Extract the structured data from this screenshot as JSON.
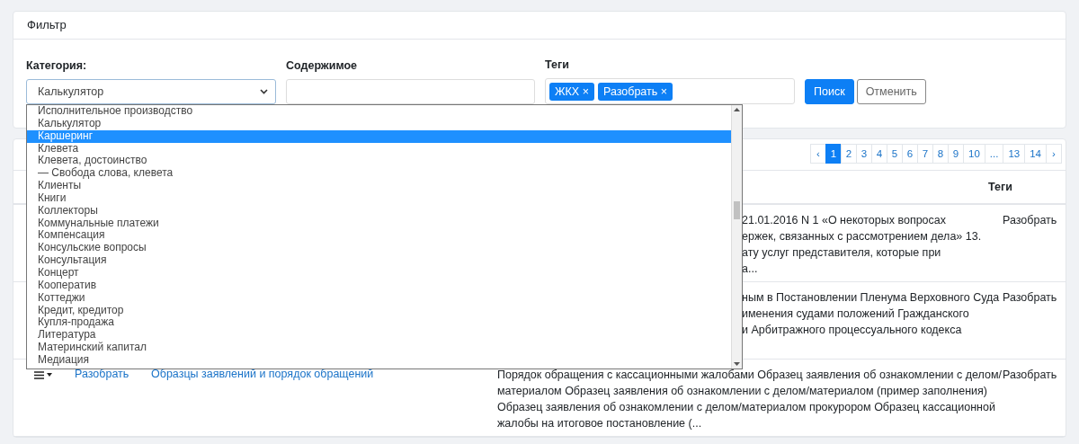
{
  "filter": {
    "title": "Фильтр",
    "category": {
      "label": "Категория:",
      "value": "Калькулятор",
      "expanded": true,
      "options": [
        {
          "label": "Исполнительное производство",
          "highlighted": false
        },
        {
          "label": "Калькулятор",
          "highlighted": false
        },
        {
          "label": "Каршеринг",
          "highlighted": true
        },
        {
          "label": "Клевета",
          "highlighted": false
        },
        {
          "label": "Клевета, достоинство",
          "highlighted": false
        },
        {
          "label": "— Свобода слова, клевета",
          "highlighted": false
        },
        {
          "label": "Клиенты",
          "highlighted": false
        },
        {
          "label": "Книги",
          "highlighted": false
        },
        {
          "label": "Коллекторы",
          "highlighted": false
        },
        {
          "label": "Коммунальные платежи",
          "highlighted": false
        },
        {
          "label": "Компенсация",
          "highlighted": false
        },
        {
          "label": "Консульские вопросы",
          "highlighted": false
        },
        {
          "label": "Консультация",
          "highlighted": false
        },
        {
          "label": "Концерт",
          "highlighted": false
        },
        {
          "label": "Кооператив",
          "highlighted": false
        },
        {
          "label": "Коттеджи",
          "highlighted": false
        },
        {
          "label": "Кредит, кредитор",
          "highlighted": false
        },
        {
          "label": "Купля-продажа",
          "highlighted": false
        },
        {
          "label": "Литература",
          "highlighted": false
        },
        {
          "label": "Материнский капитал",
          "highlighted": false
        },
        {
          "label": "Медиация",
          "highlighted": false
        }
      ]
    },
    "content": {
      "label": "Содержимое"
    },
    "tags": {
      "label": "Теги",
      "chips": [
        {
          "label": "ЖКХ",
          "remove": "×"
        },
        {
          "label": "Разобрать",
          "remove": "×"
        }
      ]
    },
    "buttons": [
      {
        "label": "Поиск",
        "kind": "primary"
      },
      {
        "label": "Отменить",
        "kind": "secondary"
      }
    ]
  },
  "pagination": [
    {
      "label": "‹",
      "selected": false
    },
    {
      "label": "1",
      "selected": true
    },
    {
      "label": "2",
      "selected": false
    },
    {
      "label": "3",
      "selected": false
    },
    {
      "label": "4",
      "selected": false
    },
    {
      "label": "5",
      "selected": false
    },
    {
      "label": "6",
      "selected": false
    },
    {
      "label": "7",
      "selected": false
    },
    {
      "label": "8",
      "selected": false
    },
    {
      "label": "9",
      "selected": false
    },
    {
      "label": "10",
      "selected": false
    },
    {
      "label": "...",
      "selected": false
    },
    {
      "label": "13",
      "selected": false
    },
    {
      "label": "14",
      "selected": false
    },
    {
      "label": "›",
      "selected": false
    }
  ],
  "table": {
    "tags_header": "Теги",
    "rows": [
      {
        "kind": "covered",
        "content_lines": [
          "21.01.2016 N 1 «О некоторых вопросах",
          "ержек, связанных с рассмотрением дела» 13.",
          "ату услуг представителя, которые при",
          "а..."
        ],
        "tags": "Разобрать"
      },
      {
        "kind": "covered",
        "content_lines": [
          "ным в Постановлении Пленума Верховного Суда",
          "именения судами положений Гражданского",
          "и Арбитражного процессуального кодекса"
        ],
        "tags": "Разобрать"
      },
      {
        "kind": "full",
        "status_link": "Разобрать",
        "title_link": "Образцы заявлений и порядок обращений",
        "content_lines": [
          "Порядок обращения с кассационными жалобами  Образец заявления об ознакомлении с делом/",
          "материалом Образец заявления об ознакомлении с делом/материалом (пример заполнения)",
          "Образец заявления об ознакомлении с делом/материалом прокурором Образец кассационной",
          "жалобы на итоговое постановление (..."
        ],
        "tags": "Разобрать"
      }
    ]
  }
}
